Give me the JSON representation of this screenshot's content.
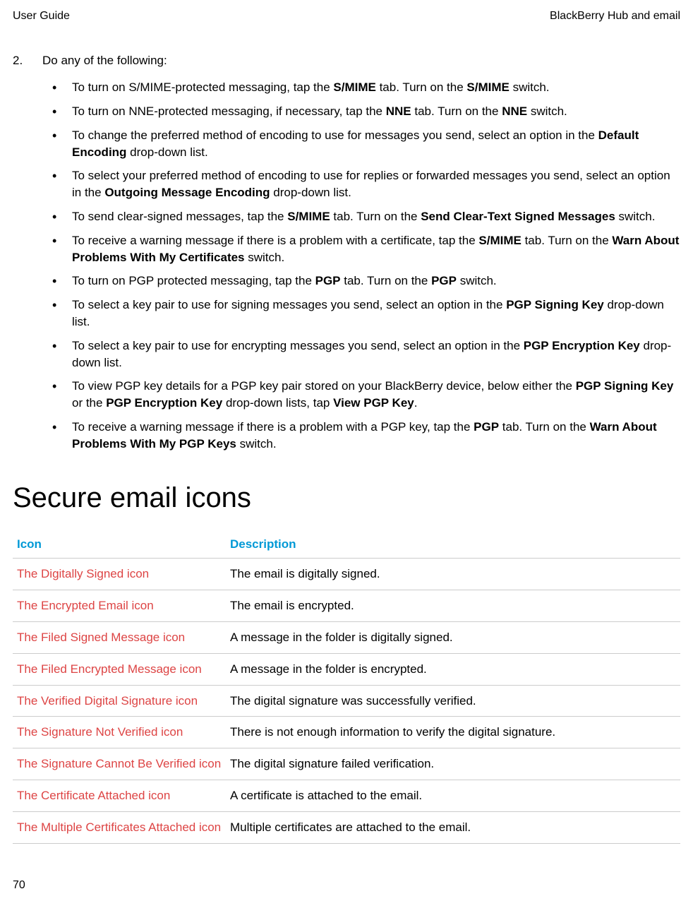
{
  "header": {
    "left": "User Guide",
    "right": "BlackBerry Hub and email"
  },
  "step": {
    "num": "2.",
    "text": "Do any of the following:"
  },
  "bullets": [
    {
      "pre": "To turn on S/MIME-protected messaging, tap the ",
      "b1": "S/MIME",
      "mid1": " tab. Turn on the ",
      "b2": "S/MIME",
      "post": " switch."
    },
    {
      "pre": "To turn on NNE-protected messaging, if necessary, tap the ",
      "b1": "NNE",
      "mid1": " tab. Turn on the ",
      "b2": "NNE",
      "post": " switch."
    },
    {
      "pre": "To change the preferred method of encoding to use for messages you send, select an option in the ",
      "b1": "Default Encoding",
      "post": " drop-down list."
    },
    {
      "pre": "To select your preferred method of encoding to use for replies or forwarded messages you send, select an option in the ",
      "b1": "Outgoing Message Encoding",
      "post": " drop-down list."
    },
    {
      "pre": "To send clear-signed messages, tap the ",
      "b1": "S/MIME",
      "mid1": " tab. Turn on the ",
      "b2": "Send Clear-Text Signed Messages",
      "post": " switch."
    },
    {
      "pre": "To receive a warning message if there is a problem with a certificate, tap the ",
      "b1": "S/MIME",
      "mid1": " tab. Turn on the ",
      "b2": "Warn About Problems With My Certificates",
      "post": " switch."
    },
    {
      "pre": "To turn on PGP protected messaging, tap the ",
      "b1": "PGP",
      "mid1": " tab. Turn on the ",
      "b2": "PGP",
      "post": " switch."
    },
    {
      "pre": "To select a key pair to use for signing messages you send, select an option in the ",
      "b1": "PGP Signing Key",
      "post": " drop-down list."
    },
    {
      "pre": "To select a key pair to use for encrypting messages you send, select an option in the ",
      "b1": "PGP Encryption Key",
      "post": " drop-down list."
    },
    {
      "pre": "To view PGP key details for a PGP key pair stored on your BlackBerry device, below either the ",
      "b1": "PGP Signing Key",
      "mid1": " or the ",
      "b2": "PGP Encryption Key",
      "mid2": " drop-down lists, tap ",
      "b3": "View PGP Key",
      "post": "."
    },
    {
      "pre": "To receive a warning message if there is a problem with a PGP key, tap the ",
      "b1": "PGP",
      "mid1": " tab. Turn on the ",
      "b2": "Warn About Problems With My PGP Keys",
      "post": " switch."
    }
  ],
  "section_title": "Secure email icons",
  "table": {
    "h1": "Icon",
    "h2": "Description",
    "rows": [
      {
        "icon": "The Digitally Signed icon",
        "desc": "The email is digitally signed."
      },
      {
        "icon": "The Encrypted Email icon",
        "desc": "The email is encrypted."
      },
      {
        "icon": "The Filed Signed Message icon",
        "desc": "A message in the folder is digitally signed."
      },
      {
        "icon": "The Filed Encrypted Message icon",
        "desc": "A message in the folder is encrypted."
      },
      {
        "icon": "The Verified Digital Signature icon",
        "desc": "The digital signature was successfully verified."
      },
      {
        "icon": "The Signature Not Verified icon",
        "desc": "There is not enough information to verify the digital signature."
      },
      {
        "icon": "The Signature Cannot Be Verified icon",
        "desc": "The digital signature failed verification."
      },
      {
        "icon": "The Certificate Attached icon",
        "desc": "A certificate is attached to the email."
      },
      {
        "icon": "The Multiple Certificates Attached icon",
        "desc": "Multiple certificates are attached to the email."
      }
    ]
  },
  "page_number": "70"
}
